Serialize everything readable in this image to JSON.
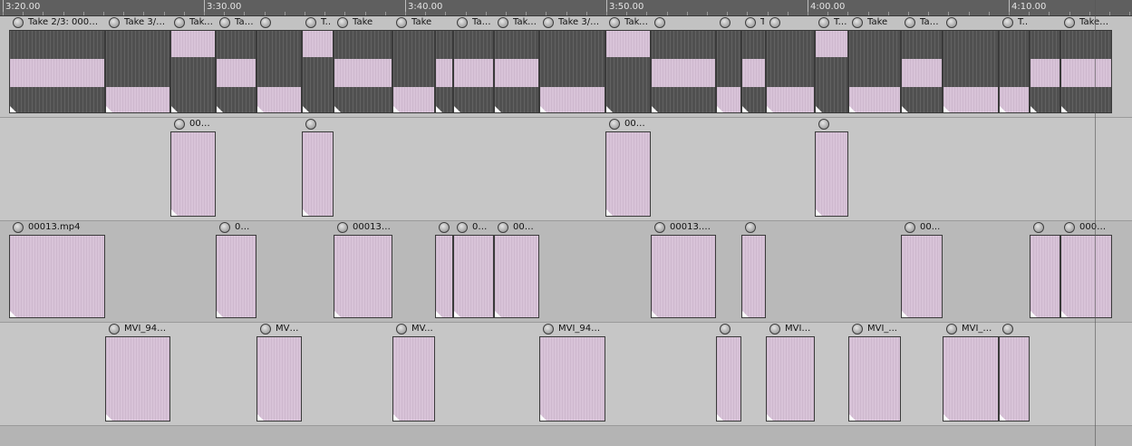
{
  "ruler": {
    "labels": [
      "3:20.00",
      "3:30.00",
      "3:40.00",
      "3:50.00",
      "4:00.00",
      "4:10.00"
    ]
  },
  "tracks": [
    {
      "name": "track-1",
      "items": [
        {
          "label": "Take 2/3: 00013...",
          "type": "video"
        },
        {
          "label": "Take 3/3:...",
          "type": "video"
        },
        {
          "label": "Take...",
          "type": "video"
        },
        {
          "label": "Take",
          "type": "video"
        },
        {
          "label": "",
          "type": "video"
        },
        {
          "label": "Take 2/...",
          "type": "video"
        },
        {
          "label": "Take",
          "type": "video"
        },
        {
          "label": "Take",
          "type": "video"
        },
        {
          "label": "Tak...",
          "type": "video"
        },
        {
          "label": "Take 3/3:...",
          "type": "video"
        },
        {
          "label": "Take 3/3:...",
          "type": "video"
        },
        {
          "label": "Take 2/3...",
          "type": "video"
        },
        {
          "label": "",
          "type": "video"
        },
        {
          "label": "",
          "type": "video"
        },
        {
          "label": "Take",
          "type": "video"
        },
        {
          "label": "",
          "type": "video"
        },
        {
          "label": "Take",
          "type": "video"
        },
        {
          "label": "Take",
          "type": "video"
        },
        {
          "label": "Take 3...",
          "type": "video"
        },
        {
          "label": "",
          "type": "video"
        },
        {
          "label": "Take",
          "type": "video"
        },
        {
          "label": "Take ...",
          "type": "video"
        }
      ]
    },
    {
      "name": "track-2",
      "items": [
        {
          "label": "000..."
        },
        {
          "label": ""
        },
        {
          "label": "000..."
        },
        {
          "label": ""
        }
      ]
    },
    {
      "name": "track-3",
      "items": [
        {
          "label": "00013.mp4"
        },
        {
          "label": "00..."
        },
        {
          "label": "00013...."
        },
        {
          "label": ""
        },
        {
          "label": "00..."
        },
        {
          "label": "000..."
        },
        {
          "label": "00013.m..."
        },
        {
          "label": ""
        },
        {
          "label": "00..."
        },
        {
          "label": ""
        },
        {
          "label": "0001..."
        }
      ]
    },
    {
      "name": "track-4",
      "items": [
        {
          "label": "MVI_943..."
        },
        {
          "label": "MVI..."
        },
        {
          "label": "MV..."
        },
        {
          "label": "MVI_943..."
        },
        {
          "label": ""
        },
        {
          "label": "MVI_..."
        },
        {
          "label": "MVI_..."
        },
        {
          "label": "MVI_9..."
        },
        {
          "label": ""
        }
      ]
    }
  ],
  "colors": {
    "item_fill": "#d8c3d8",
    "video_fill": "#505050",
    "ruler_bg": "#5f5f5f",
    "lane_bg": "#bebebe"
  }
}
